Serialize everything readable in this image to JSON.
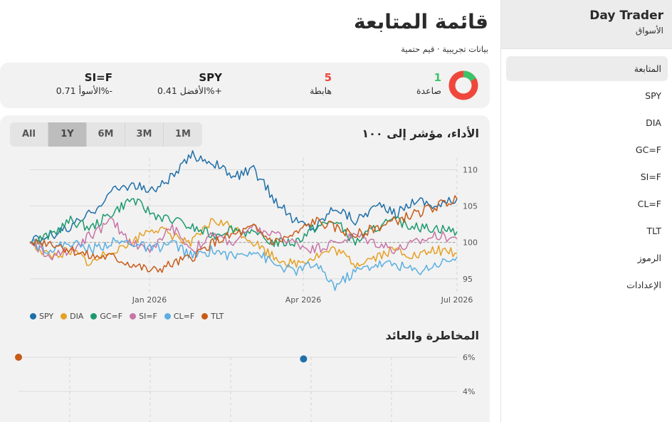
{
  "sidebar": {
    "brand": "Day Trader",
    "subtitle": "الأسواق",
    "items": [
      "المتابعة",
      "SPY",
      "DIA",
      "GC=F",
      "SI=F",
      "CL=F",
      "TLT",
      "الرموز",
      "الإعدادات"
    ],
    "active_index": 0
  },
  "header": {
    "title": "قائمة المتابعة",
    "subtitle": "بيانات تجريبية · قيم حتمية"
  },
  "summary": {
    "up": {
      "value": "1",
      "label": "صاعدة",
      "color": "#3cc36a"
    },
    "down": {
      "value": "5",
      "label": "هابطة",
      "color": "#f0473c"
    },
    "best": {
      "symbol": "SPY",
      "label": "الأفضل 0.41%+"
    },
    "worst": {
      "symbol": "SI=F",
      "label": "الأسوأ 0.71%-"
    },
    "donut": {
      "up_count": 1,
      "down_count": 5
    }
  },
  "performance": {
    "title": "الأداء، مؤشر إلى ١٠٠",
    "ranges": [
      "All",
      "1Y",
      "6M",
      "3M",
      "1M"
    ],
    "active_range": "1Y"
  },
  "risk": {
    "title": "المخاطرة والعائد",
    "y_ticks": [
      "6%",
      "4%"
    ]
  },
  "chart_data": [
    {
      "type": "line",
      "title": "الأداء، مؤشر إلى ١٠٠",
      "x_ticks": [
        "Jan 2026",
        "Apr 2026",
        "Jul 2026"
      ],
      "y_ticks": [
        95,
        100,
        105,
        110
      ],
      "ylim": [
        94,
        112
      ],
      "baseline": 100,
      "legend": "bottom-left",
      "series": [
        {
          "name": "SPY",
          "color": "#1f6fa8",
          "values": [
            100,
            101,
            102,
            104,
            107,
            108,
            107,
            109,
            112,
            111,
            109,
            110,
            106,
            103,
            102,
            105,
            103,
            105,
            104,
            106,
            105,
            106
          ]
        },
        {
          "name": "DIA",
          "color": "#e6a023",
          "values": [
            100,
            98,
            99,
            97,
            99,
            100,
            102,
            101,
            100,
            103,
            102,
            100,
            98,
            97,
            98,
            99,
            97,
            98,
            99,
            98,
            99,
            98.5
          ]
        },
        {
          "name": "GC=F",
          "color": "#1c9a6e",
          "values": [
            100,
            101,
            103,
            102,
            104,
            106,
            104,
            103,
            102,
            101,
            102,
            101,
            100,
            100,
            102,
            103,
            100,
            102,
            103,
            102,
            102,
            101.5
          ]
        },
        {
          "name": "SI=F",
          "color": "#c874a6",
          "values": [
            100,
            98,
            99,
            101,
            103,
            100,
            99,
            102,
            99,
            101,
            100,
            102,
            101,
            100,
            99,
            100,
            101,
            100,
            99,
            100,
            101,
            100.5
          ]
        },
        {
          "name": "CL=F",
          "color": "#5aaee0",
          "values": [
            100,
            99,
            100,
            99,
            100,
            100,
            99,
            100,
            98,
            99,
            98,
            99,
            97,
            96,
            97,
            94,
            96,
            97,
            97,
            96,
            97,
            98
          ]
        },
        {
          "name": "TLT",
          "color": "#c85a17",
          "values": [
            100,
            100,
            99,
            98,
            98,
            97,
            96,
            97,
            98,
            100,
            101,
            102,
            100,
            101,
            103,
            102,
            101,
            102,
            103,
            104,
            105,
            106
          ]
        }
      ]
    },
    {
      "type": "scatter",
      "title": "المخاطرة والعائد",
      "y_ticks": [
        "6%",
        "4%"
      ],
      "points": [
        {
          "color": "#c85a17",
          "y": 6.0,
          "xfrac": 0.0
        },
        {
          "color": "#1f6fa8",
          "y": 5.9,
          "xfrac": 0.65
        }
      ]
    }
  ]
}
